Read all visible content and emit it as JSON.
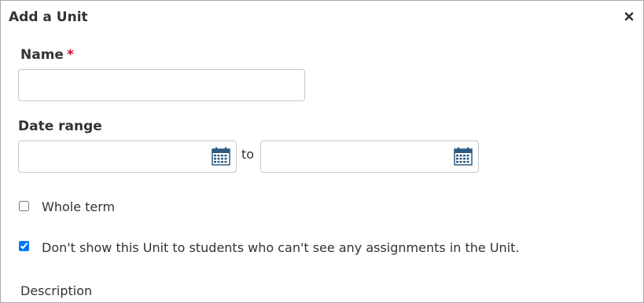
{
  "dialog": {
    "title": "Add a Unit",
    "close_icon": "close-icon"
  },
  "name_field": {
    "label": "Name",
    "required_marker": "*",
    "value": "",
    "placeholder": ""
  },
  "date_range": {
    "label": "Date range",
    "start": {
      "value": "",
      "placeholder": "",
      "icon": "calendar-icon"
    },
    "separator": "to",
    "end": {
      "value": "",
      "placeholder": "",
      "icon": "calendar-icon"
    }
  },
  "options": {
    "whole_term": {
      "label": "Whole term",
      "checked": false
    },
    "hide_unit": {
      "label": "Don't show this Unit to students who can't see any assignments in the Unit.",
      "checked": true
    }
  },
  "description": {
    "label": "Description"
  },
  "colors": {
    "required": "#c8102e",
    "calendar_icon": "#2d5a82",
    "border": "#c6c6c6",
    "checkbox_accent": "#0075ff"
  }
}
